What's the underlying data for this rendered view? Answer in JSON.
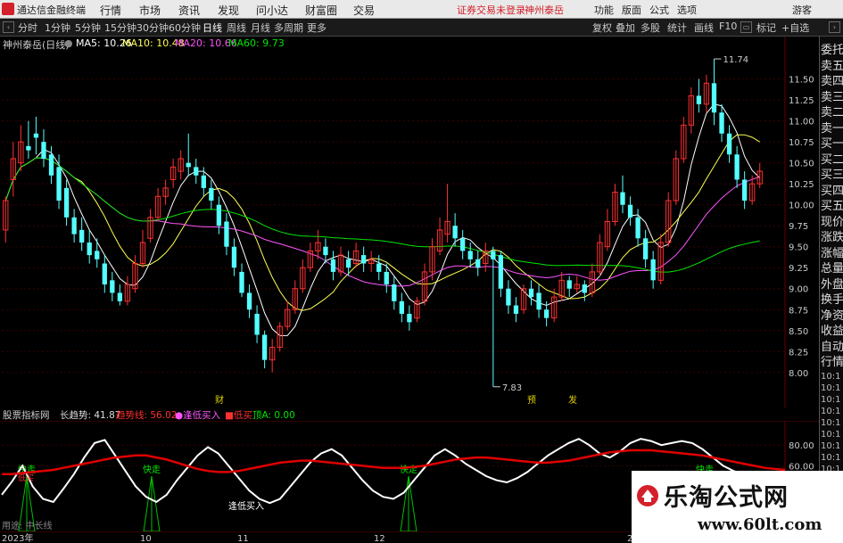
{
  "titlebar": {
    "app_name": "通达信金融终端",
    "menus": [
      "行情",
      "市场",
      "资讯",
      "发现",
      "问小达",
      "财富圈",
      "交易"
    ],
    "notice": "证券交易未登录",
    "stock_link": "神州泰岳",
    "right_menus": [
      "功能",
      "版面",
      "公式",
      "选项"
    ],
    "guest": "游客"
  },
  "toolbar": {
    "periods": [
      "分时",
      "1分钟",
      "5分钟",
      "15分钟",
      "30分钟",
      "60分钟",
      "日线",
      "周线",
      "月线",
      "多周期",
      "更多"
    ],
    "active_period": "日线",
    "tools": [
      "复权",
      "叠加",
      "多股",
      "统计",
      "画线",
      "F10",
      "标记",
      "+自选"
    ]
  },
  "ma_legend": {
    "stock": "神州泰岳(日线)",
    "ma5": "MA5: 10.26",
    "ma10": "MA10: 10.48",
    "ma20": "MA20: 10.66",
    "ma60": "MA60: 9.73"
  },
  "colors": {
    "up": "#ff3030",
    "down": "#54ffff",
    "ma5": "#ffffff",
    "ma10": "#ffff54",
    "ma20": "#ff54ff",
    "ma60": "#00e600",
    "long_line": "#ffffff",
    "trend_line": "#e00000"
  },
  "price_axis": {
    "ticks": [
      "11.50",
      "11.25",
      "11.00",
      "10.75",
      "10.50",
      "10.25",
      "10.00",
      "9.75",
      "9.50",
      "9.25",
      "9.00",
      "8.75",
      "8.50",
      "8.25",
      "8.00"
    ],
    "max_label": "11.74",
    "min_label": "7.83"
  },
  "markers": [
    "财",
    "预",
    "发"
  ],
  "indicator": {
    "name": "股票指标网",
    "long_trend": "长趋势: 41.87",
    "trend_line": "趋势线: 56.02",
    "bottom_buy": "●逢低买入",
    "low_buy": "■低买",
    "top_a": "顶A: 0.00",
    "axis_ticks": [
      "80.00",
      "60.00"
    ],
    "signal_label": "快走",
    "low_buy_text": "低买",
    "bottom_buy_text": "逢低买入",
    "ann_10": "10"
  },
  "date_axis": {
    "labels": [
      "2023年",
      "10",
      "11",
      "12",
      "2"
    ]
  },
  "side_panel": {
    "items": [
      "委托",
      "卖五",
      "卖四",
      "卖三",
      "卖二",
      "卖一",
      "买一",
      "买二",
      "买三",
      "买四",
      "买五",
      "现价",
      "涨跌",
      "涨幅",
      "总量",
      "外盘",
      "换手",
      "净资",
      "收益",
      "自动",
      "行情"
    ],
    "times": [
      "10:1",
      "10:1",
      "10:1",
      "10:1",
      "10:1",
      "10:1",
      "10:1",
      "10:1",
      "10:1",
      "10:1",
      "10:1",
      "10:1",
      "10:1",
      "10:1"
    ]
  },
  "usage_note": "用途: 中长线",
  "watermark": {
    "title": "乐淘公式网",
    "url": "www.60lt.com"
  },
  "chart_data": [
    {
      "type": "candlestick",
      "title": "神州泰岳(日线)",
      "ylim": [
        7.7,
        11.9
      ],
      "candles": [
        [
          9.7,
          10.05,
          10.1,
          9.55
        ],
        [
          10.3,
          10.55,
          10.75,
          10.1
        ],
        [
          10.5,
          10.75,
          10.95,
          10.4
        ],
        [
          10.7,
          10.65,
          11.0,
          10.55
        ],
        [
          10.85,
          10.8,
          11.05,
          10.6
        ],
        [
          10.75,
          10.55,
          10.9,
          10.45
        ],
        [
          10.6,
          10.35,
          10.7,
          10.25
        ],
        [
          10.45,
          10.05,
          10.6,
          9.95
        ],
        [
          10.2,
          9.85,
          10.3,
          9.75
        ],
        [
          9.85,
          9.65,
          9.95,
          9.55
        ],
        [
          9.7,
          9.55,
          9.85,
          9.45
        ],
        [
          9.55,
          9.4,
          9.7,
          9.3
        ],
        [
          9.45,
          9.35,
          9.6,
          9.25
        ],
        [
          9.3,
          9.05,
          9.4,
          8.95
        ],
        [
          9.1,
          8.95,
          9.2,
          8.85
        ],
        [
          8.95,
          8.85,
          9.05,
          8.8
        ],
        [
          8.85,
          9.05,
          9.15,
          8.8
        ],
        [
          9.0,
          9.3,
          9.4,
          8.95
        ],
        [
          9.3,
          9.55,
          9.7,
          9.25
        ],
        [
          9.6,
          9.85,
          9.95,
          9.55
        ],
        [
          9.85,
          10.1,
          10.2,
          9.8
        ],
        [
          10.1,
          10.2,
          10.3,
          10.0
        ],
        [
          10.3,
          10.45,
          10.55,
          10.2
        ],
        [
          10.4,
          10.55,
          10.65,
          10.3
        ],
        [
          10.5,
          10.45,
          10.85,
          10.35
        ],
        [
          10.45,
          10.35,
          10.55,
          10.25
        ],
        [
          10.35,
          10.2,
          10.45,
          10.1
        ],
        [
          10.2,
          10.05,
          10.3,
          9.95
        ],
        [
          10.0,
          9.75,
          10.1,
          9.65
        ],
        [
          9.8,
          9.5,
          9.9,
          9.4
        ],
        [
          9.5,
          9.25,
          9.6,
          9.15
        ],
        [
          9.2,
          8.95,
          9.3,
          8.9
        ],
        [
          8.95,
          8.75,
          9.05,
          8.65
        ],
        [
          8.7,
          8.45,
          8.8,
          8.35
        ],
        [
          8.45,
          8.15,
          8.5,
          8.05
        ],
        [
          8.15,
          8.3,
          8.4,
          8.0
        ],
        [
          8.3,
          8.55,
          8.6,
          8.25
        ],
        [
          8.55,
          8.75,
          8.85,
          8.5
        ],
        [
          8.75,
          9.0,
          9.1,
          8.7
        ],
        [
          9.0,
          9.25,
          9.35,
          8.95
        ],
        [
          9.25,
          9.45,
          9.55,
          9.2
        ],
        [
          9.45,
          9.55,
          9.7,
          9.35
        ],
        [
          9.5,
          9.4,
          9.6,
          9.3
        ],
        [
          9.35,
          9.2,
          9.45,
          9.1
        ],
        [
          9.2,
          9.4,
          9.5,
          9.15
        ],
        [
          9.35,
          9.25,
          9.45,
          9.15
        ],
        [
          9.3,
          9.45,
          9.55,
          9.25
        ],
        [
          9.4,
          9.3,
          9.5,
          9.2
        ],
        [
          9.3,
          9.35,
          9.45,
          9.2
        ],
        [
          9.3,
          9.2,
          9.4,
          9.1
        ],
        [
          9.2,
          9.05,
          9.3,
          8.95
        ],
        [
          9.05,
          8.85,
          9.15,
          8.75
        ],
        [
          8.85,
          8.7,
          8.95,
          8.6
        ],
        [
          8.7,
          8.6,
          8.8,
          8.5
        ],
        [
          8.65,
          8.85,
          8.9,
          8.6
        ],
        [
          8.85,
          9.2,
          9.3,
          8.8
        ],
        [
          9.2,
          9.5,
          9.6,
          9.1
        ],
        [
          9.45,
          9.7,
          9.85,
          9.4
        ],
        [
          9.65,
          9.8,
          10.25,
          9.55
        ],
        [
          9.75,
          9.6,
          9.9,
          9.5
        ],
        [
          9.6,
          9.45,
          9.7,
          9.35
        ],
        [
          9.45,
          9.35,
          9.55,
          9.25
        ],
        [
          9.35,
          9.25,
          9.45,
          9.15
        ],
        [
          9.3,
          9.45,
          9.55,
          9.2
        ],
        [
          9.45,
          9.35,
          9.5,
          7.83
        ],
        [
          9.4,
          9.0,
          9.45,
          8.9
        ],
        [
          9.0,
          8.8,
          9.1,
          8.7
        ],
        [
          8.8,
          8.7,
          8.9,
          8.6
        ],
        [
          8.75,
          9.0,
          9.05,
          8.7
        ],
        [
          9.0,
          8.9,
          9.1,
          8.8
        ],
        [
          8.95,
          8.75,
          9.05,
          8.65
        ],
        [
          8.75,
          8.65,
          8.85,
          8.55
        ],
        [
          8.65,
          8.9,
          9.0,
          8.6
        ],
        [
          8.9,
          9.1,
          9.2,
          8.85
        ],
        [
          9.1,
          9.0,
          9.15,
          8.9
        ],
        [
          9.0,
          9.05,
          9.15,
          8.95
        ],
        [
          9.05,
          8.95,
          9.1,
          8.85
        ],
        [
          8.95,
          9.2,
          9.3,
          8.9
        ],
        [
          9.2,
          9.55,
          9.65,
          9.15
        ],
        [
          9.5,
          9.8,
          9.95,
          9.45
        ],
        [
          9.8,
          10.15,
          10.25,
          9.75
        ],
        [
          10.15,
          10.0,
          10.35,
          9.9
        ],
        [
          10.0,
          9.85,
          10.1,
          9.75
        ],
        [
          9.85,
          9.6,
          9.95,
          9.5
        ],
        [
          9.6,
          9.35,
          9.7,
          9.25
        ],
        [
          9.35,
          9.1,
          9.45,
          9.0
        ],
        [
          9.1,
          9.55,
          9.65,
          9.05
        ],
        [
          9.55,
          10.05,
          10.15,
          9.5
        ],
        [
          10.05,
          10.55,
          10.65,
          10.0
        ],
        [
          10.55,
          10.95,
          11.05,
          10.5
        ],
        [
          10.95,
          11.3,
          11.4,
          10.85
        ],
        [
          11.3,
          11.2,
          11.5,
          11.1
        ],
        [
          11.2,
          11.45,
          11.55,
          11.1
        ],
        [
          11.45,
          11.1,
          11.74,
          10.95
        ],
        [
          11.1,
          10.85,
          11.2,
          10.75
        ],
        [
          10.85,
          10.6,
          10.95,
          10.5
        ],
        [
          10.6,
          10.3,
          10.7,
          10.2
        ],
        [
          10.3,
          10.05,
          10.4,
          9.95
        ],
        [
          10.05,
          10.25,
          10.35,
          10.0
        ],
        [
          10.25,
          10.4,
          10.5,
          10.2
        ]
      ],
      "ma_series": [
        "MA5",
        "MA10",
        "MA20",
        "MA60"
      ]
    },
    {
      "type": "line",
      "title": "股票指标网",
      "ylim": [
        0,
        100
      ],
      "series": [
        {
          "name": "长趋势",
          "values": [
            32,
            45,
            60,
            40,
            28,
            25,
            38,
            52,
            68,
            82,
            85,
            70,
            55,
            40,
            30,
            25,
            32,
            46,
            58,
            70,
            78,
            72,
            60,
            48,
            36,
            28,
            24,
            28,
            40,
            52,
            64,
            72,
            76,
            70,
            58,
            46,
            36,
            30,
            28,
            34,
            46,
            58,
            70,
            76,
            70,
            62,
            56,
            50,
            46,
            44,
            48,
            54,
            62,
            70,
            76,
            82,
            86,
            80,
            72,
            68,
            74,
            82,
            86,
            84,
            80,
            82,
            84,
            82,
            76,
            68,
            60,
            55,
            52,
            48,
            44,
            42,
            41.87
          ]
        },
        {
          "name": "趋势线",
          "values": [
            52,
            52,
            53,
            54,
            55,
            56,
            58,
            60,
            62,
            64,
            66,
            68,
            69,
            70,
            70,
            68,
            66,
            63,
            60,
            57,
            55,
            54,
            54,
            55,
            57,
            59,
            61,
            63,
            64,
            65,
            65,
            64,
            63,
            62,
            61,
            60,
            59,
            58,
            58,
            58,
            59,
            60,
            62,
            64,
            66,
            67,
            68,
            68,
            67,
            66,
            65,
            64,
            63,
            63,
            64,
            65,
            67,
            69,
            71,
            73,
            74,
            75,
            75,
            75,
            74,
            73,
            72,
            71,
            70,
            68,
            66,
            64,
            62,
            60,
            58,
            57,
            56.02
          ]
        }
      ]
    }
  ]
}
